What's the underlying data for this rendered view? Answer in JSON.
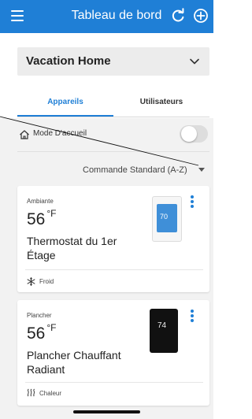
{
  "header": {
    "title": "Tableau de bord",
    "icons": [
      "menu-icon",
      "refresh-icon",
      "add-icon"
    ],
    "accent_color": "#1f7fd6"
  },
  "location": {
    "selected": "Vacation Home"
  },
  "tabs": [
    {
      "label": "Appareils",
      "active": true
    },
    {
      "label": "Utilisateurs",
      "active": false
    }
  ],
  "home_mode": {
    "label": "Mode D'accueil",
    "enabled": false
  },
  "sort": {
    "label": "Commande Standard (A-Z)"
  },
  "devices": [
    {
      "type": "Ambiante",
      "temperature": "56",
      "unit": "°F",
      "name": "Thermostat du 1er Étage",
      "mode": "Froid",
      "mode_icon": "snowflake-icon",
      "display_value": "70"
    },
    {
      "type": "Plancher",
      "temperature": "56",
      "unit": "°F",
      "name": "Plancher Chauffant Radiant",
      "mode": "Chaleur",
      "mode_icon": "heat-waves-icon",
      "display_value": "74"
    }
  ]
}
